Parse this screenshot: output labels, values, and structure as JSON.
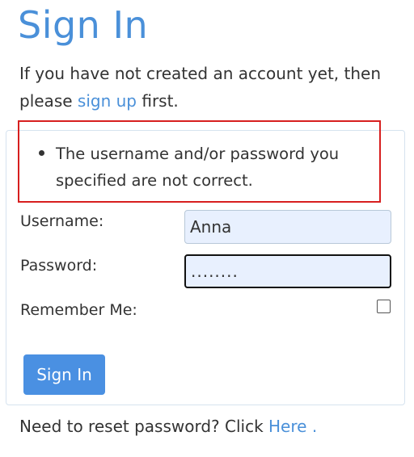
{
  "header": {
    "title": "Sign In"
  },
  "intro": {
    "prefix": "If you have not created an account yet, then please",
    "link": "sign up",
    "suffix": "first."
  },
  "errors": [
    "The username and/or password you specified are not correct."
  ],
  "form": {
    "username_label": "Username:",
    "username_value": "Anna",
    "password_label": "Password:",
    "password_value": "........",
    "remember_label": "Remember Me:",
    "remember_checked": false,
    "submit_label": "Sign In"
  },
  "footer": {
    "prefix": "Need to reset password? Click",
    "link": "Here",
    "suffix": "."
  },
  "colors": {
    "accent": "#4a90d9",
    "error_border": "#d71f1f",
    "input_fill": "#e8f0fe",
    "button": "#4a90e2"
  }
}
